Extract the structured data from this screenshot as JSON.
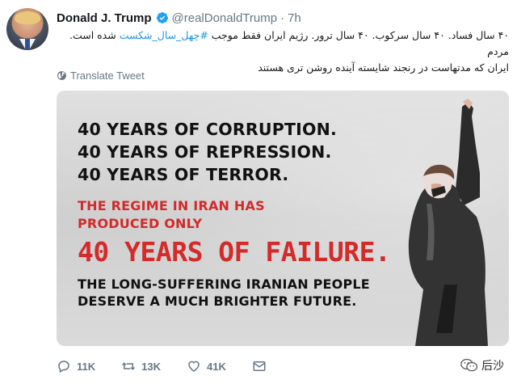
{
  "tweet": {
    "display_name": "Donald J. Trump",
    "handle": "@realDonaldTrump",
    "separator": "·",
    "time": "7h",
    "text_line1_before": "۴۰ سال فساد. ۴۰ سال سرکوب. ۴۰ سال ترور. رژیم ایران فقط موجب ",
    "hashtag": "#چهل_سال_شکست",
    "text_line1_after": " شده است. مردم",
    "text_line2": "ایران که مدتهاست در رنجند شایسته آینده روشن تری هستند",
    "translate_label": "Translate Tweet"
  },
  "poster": {
    "line1": "40 YEARS OF CORRUPTION.",
    "line2": "40 YEARS OF REPRESSION.",
    "line3": "40 YEARS OF TERROR.",
    "red_line1": "THE REGIME IN IRAN HAS",
    "red_line2": "PRODUCED ONLY",
    "red_big": "40 YEARS OF FAILURE.",
    "bottom_line1": "THE LONG-SUFFERING IRANIAN PEOPLE",
    "bottom_line2": "DESERVE A MUCH BRIGHTER FUTURE."
  },
  "actions": {
    "replies": "11K",
    "retweets": "13K",
    "likes": "41K"
  },
  "watermark": {
    "label": "后沙"
  },
  "colors": {
    "link": "#1b95e0",
    "muted": "#657786",
    "poster_red": "#d32a2a"
  },
  "icons": [
    "verified-badge-icon",
    "globe-icon",
    "reply-icon",
    "retweet-icon",
    "like-icon",
    "message-icon",
    "wechat-icon"
  ]
}
